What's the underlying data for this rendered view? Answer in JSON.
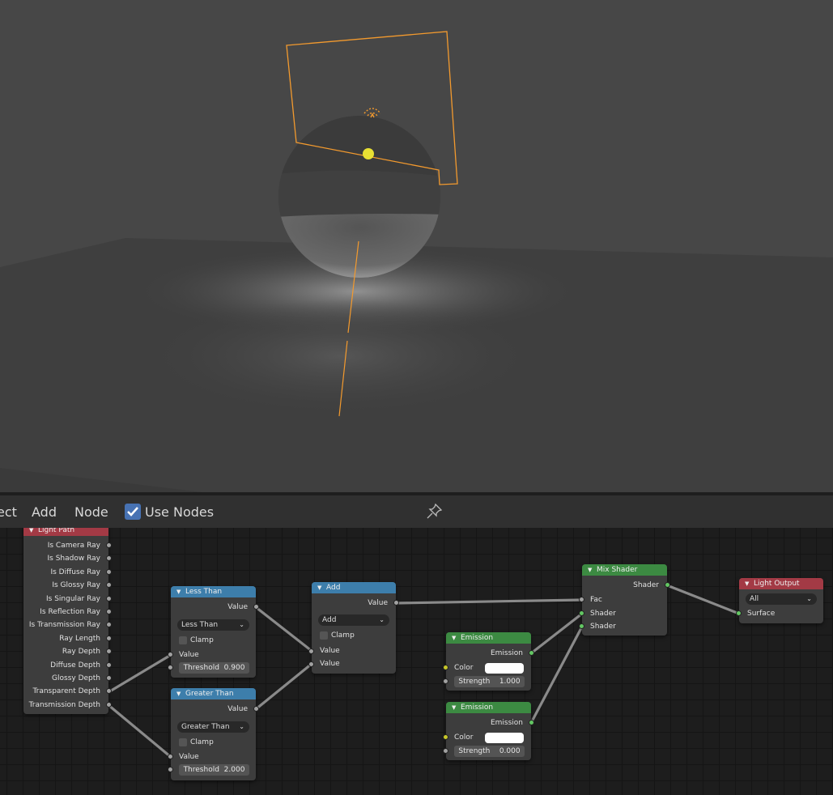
{
  "header": {
    "menus": [
      "ect",
      "Add",
      "Node"
    ],
    "use_nodes_label": "Use Nodes",
    "use_nodes_checked": true,
    "pin_icon": "pin-icon"
  },
  "colors": {
    "selection_orange": "#f39a2e",
    "light_yellow": "#e8e033",
    "checkbox_blue": "#4772b3",
    "header_input_red": "#a33a45",
    "header_converter_blue": "#3d7eab",
    "header_shader_green": "#3c8a42"
  },
  "nodes": {
    "light_path": {
      "title": "Light Path",
      "outputs": [
        "Is Camera Ray",
        "Is Shadow Ray",
        "Is Diffuse Ray",
        "Is Glossy Ray",
        "Is Singular Ray",
        "Is Reflection Ray",
        "Is Transmission Ray",
        "Ray Length",
        "Ray Depth",
        "Diffuse Depth",
        "Glossy Depth",
        "Transparent Depth",
        "Transmission Depth"
      ]
    },
    "less_than": {
      "title": "Less Than",
      "output": "Value",
      "operation": "Less Than",
      "clamp_label": "Clamp",
      "input": "Value",
      "threshold_label": "Threshold",
      "threshold_value": "0.900"
    },
    "greater_than": {
      "title": "Greater Than",
      "output": "Value",
      "operation": "Greater Than",
      "clamp_label": "Clamp",
      "input": "Value",
      "threshold_label": "Threshold",
      "threshold_value": "2.000"
    },
    "add": {
      "title": "Add",
      "output": "Value",
      "operation": "Add",
      "clamp_label": "Clamp",
      "input1": "Value",
      "input2": "Value"
    },
    "emission1": {
      "title": "Emission",
      "output": "Emission",
      "color_label": "Color",
      "color_value": "#ffffff",
      "strength_label": "Strength",
      "strength_value": "1.000"
    },
    "emission2": {
      "title": "Emission",
      "output": "Emission",
      "color_label": "Color",
      "color_value": "#ffffff",
      "strength_label": "Strength",
      "strength_value": "0.000"
    },
    "mix_shader": {
      "title": "Mix Shader",
      "output": "Shader",
      "inputs": [
        "Fac",
        "Shader",
        "Shader"
      ]
    },
    "light_output": {
      "title": "Light Output",
      "target": "All",
      "input": "Surface"
    }
  }
}
